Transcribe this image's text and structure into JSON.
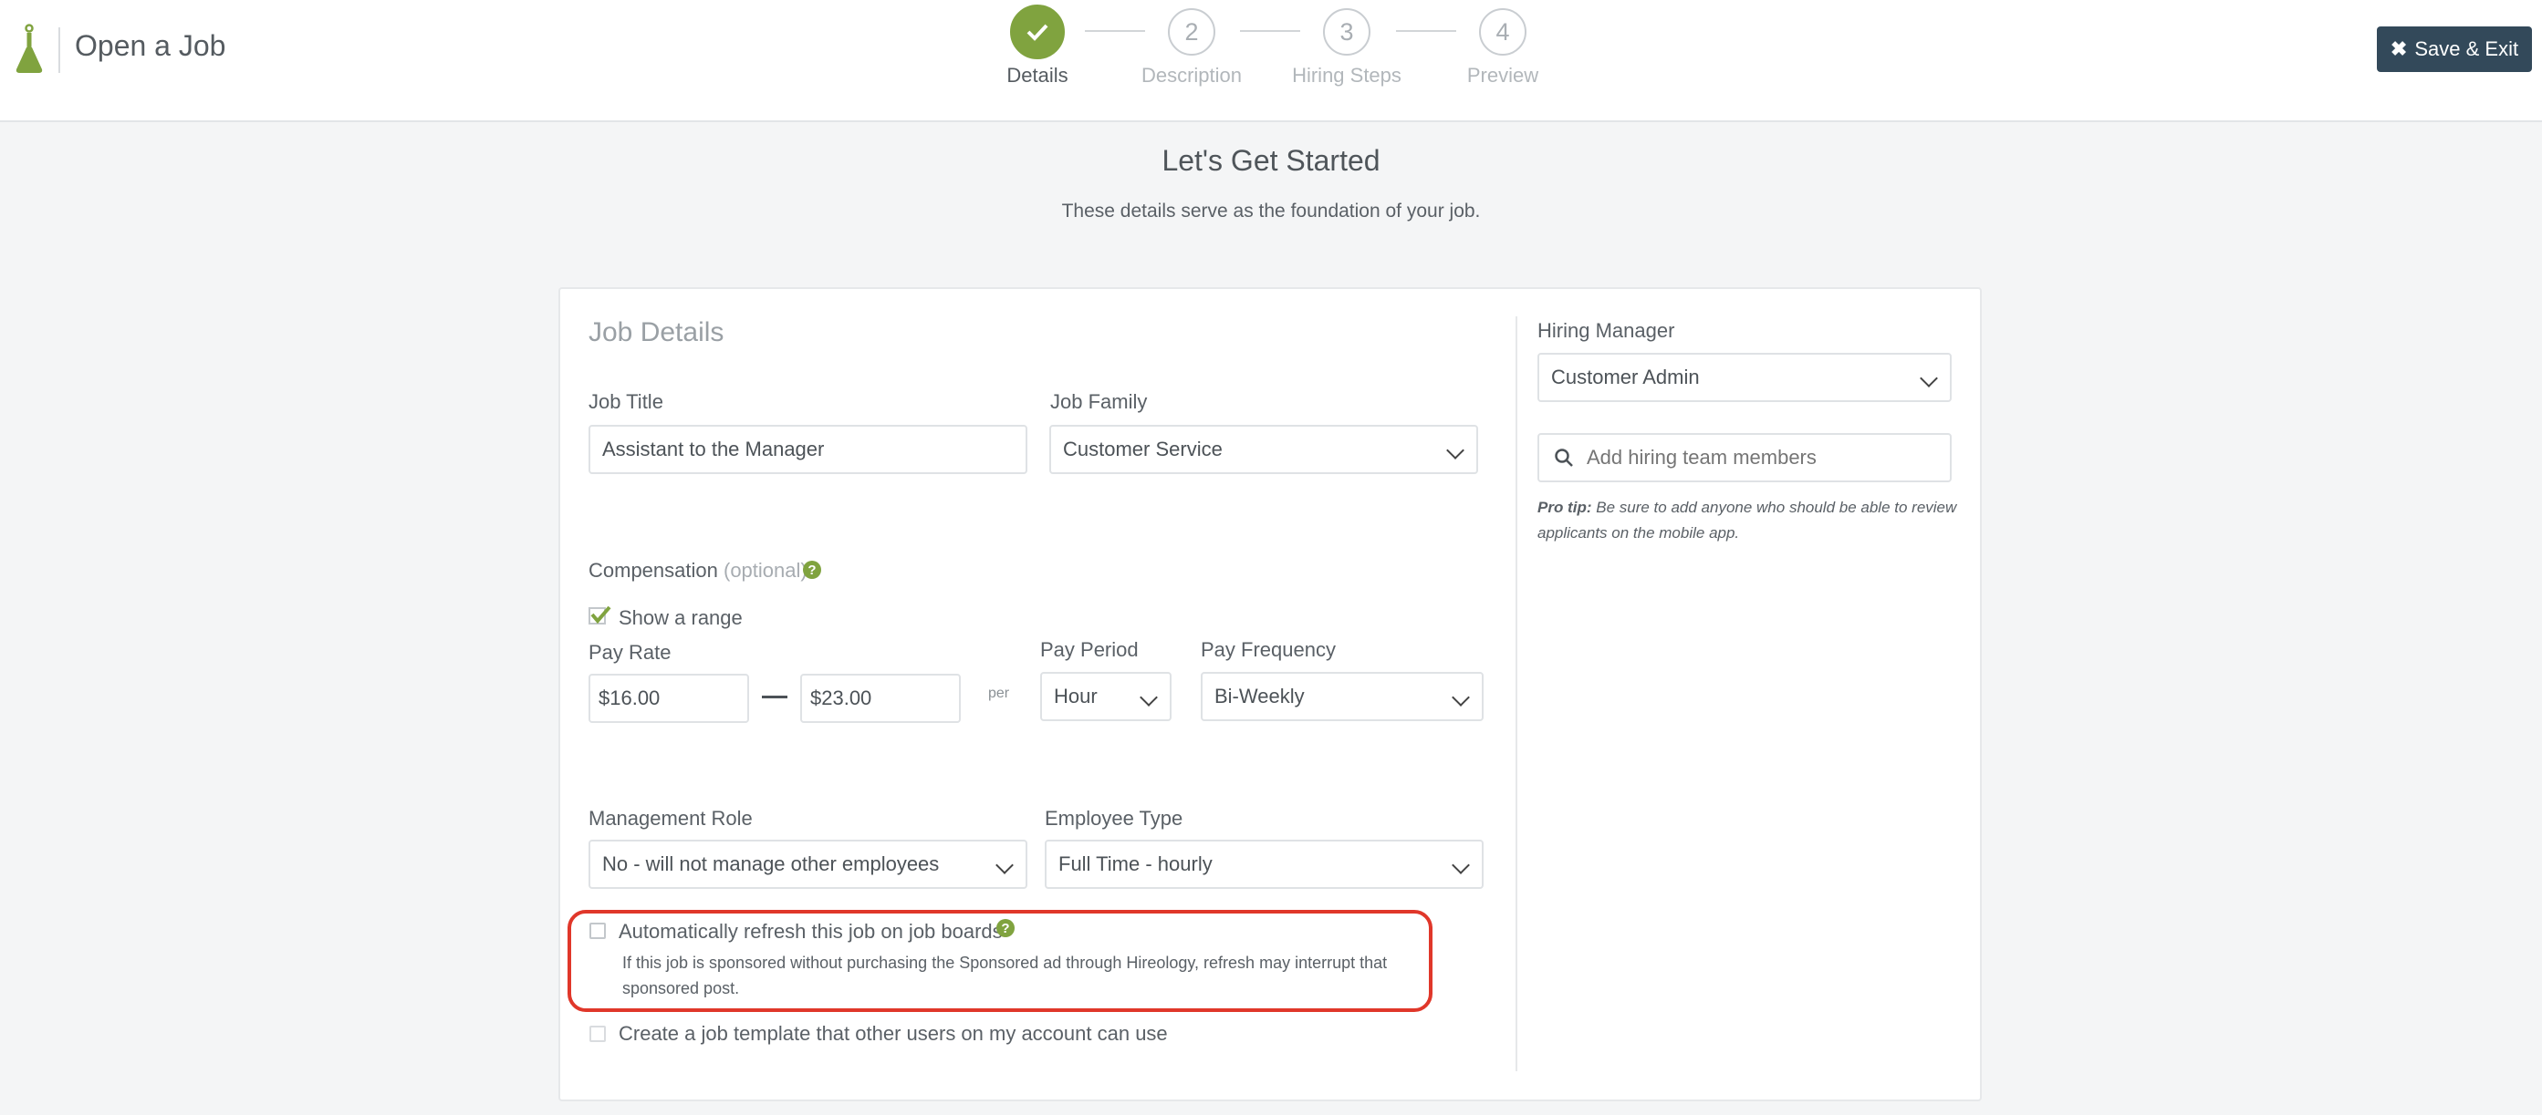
{
  "header": {
    "title": "Open a Job",
    "save_exit_label": "Save & Exit",
    "steps": [
      {
        "number": "",
        "label": "Details",
        "state": "complete"
      },
      {
        "number": "2",
        "label": "Description",
        "state": "pending"
      },
      {
        "number": "3",
        "label": "Hiring Steps",
        "state": "pending"
      },
      {
        "number": "4",
        "label": "Preview",
        "state": "pending"
      }
    ]
  },
  "intro": {
    "title": "Let's Get Started",
    "subtitle": "These details serve as the foundation of your job."
  },
  "job_details": {
    "section_title": "Job Details",
    "job_title_label": "Job Title",
    "job_title_value": "Assistant to the Manager",
    "job_family_label": "Job Family",
    "job_family_value": "Customer Service",
    "compensation_label": "Compensation",
    "compensation_optional": "(optional)",
    "show_range_label": "Show a range",
    "show_range_checked": true,
    "pay_rate_label": "Pay Rate",
    "pay_rate_min": "$16.00",
    "pay_rate_max": "$23.00",
    "per_label": "per",
    "pay_period_label": "Pay Period",
    "pay_period_value": "Hour",
    "pay_frequency_label": "Pay Frequency",
    "pay_frequency_value": "Bi-Weekly",
    "management_role_label": "Management Role",
    "management_role_value": "No - will not manage other employees",
    "employee_type_label": "Employee Type",
    "employee_type_value": "Full Time - hourly",
    "auto_refresh_label": "Automatically refresh this job on job boards",
    "auto_refresh_checked": false,
    "auto_refresh_note": "If this job is sponsored without purchasing the Sponsored ad through Hireology, refresh may interrupt that sponsored post.",
    "template_label": "Create a job template that other users on my account can use",
    "template_checked": false
  },
  "hiring": {
    "manager_label": "Hiring Manager",
    "manager_value": "Customer Admin",
    "team_placeholder": "Add hiring team members",
    "pro_tip_label": "Pro tip:",
    "pro_tip_text": "Be sure to add anyone who should be able to review applicants on the mobile app."
  },
  "colors": {
    "accent_green": "#80a33f",
    "button_dark": "#33495a",
    "highlight_red": "#e0372a"
  },
  "icons": {
    "logo": "flask-icon",
    "step_complete": "check-icon",
    "save_exit": "close-icon",
    "help": "question-icon",
    "search": "search-icon",
    "dropdown": "chevron-down-icon"
  }
}
